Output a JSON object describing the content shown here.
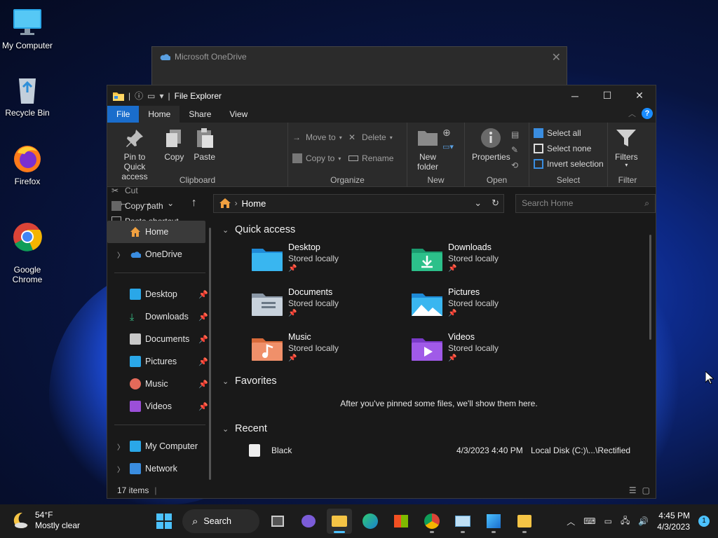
{
  "desktop": {
    "icons": [
      {
        "label": "My Computer"
      },
      {
        "label": "Recycle Bin"
      },
      {
        "label": "Firefox"
      },
      {
        "label": "Google\nChrome"
      }
    ]
  },
  "onedrive_window": {
    "title": "Microsoft OneDrive"
  },
  "explorer": {
    "title": "File Explorer",
    "tabs": [
      "File",
      "Home",
      "Share",
      "View"
    ],
    "ribbon": {
      "clipboard": {
        "pin": "Pin to Quick access",
        "copy": "Copy",
        "paste": "Paste",
        "cut": "Cut",
        "copy_path": "Copy path",
        "paste_shortcut": "Paste shortcut",
        "label": "Clipboard"
      },
      "organize": {
        "move_to": "Move to",
        "copy_to": "Copy to",
        "delete": "Delete",
        "rename": "Rename",
        "label": "Organize"
      },
      "new": {
        "new_folder": "New folder",
        "label": "New"
      },
      "open": {
        "properties": "Properties",
        "label": "Open"
      },
      "select": {
        "select_all": "Select all",
        "select_none": "Select none",
        "invert": "Invert selection",
        "label": "Select"
      },
      "filter": {
        "filters": "Filters",
        "label": "Filter"
      }
    },
    "address": {
      "path": "Home"
    },
    "search": {
      "placeholder": "Search Home"
    },
    "sidebar": {
      "items": [
        {
          "label": "Home"
        },
        {
          "label": "OneDrive"
        },
        {
          "label": "Desktop"
        },
        {
          "label": "Downloads"
        },
        {
          "label": "Documents"
        },
        {
          "label": "Pictures"
        },
        {
          "label": "Music"
        },
        {
          "label": "Videos"
        },
        {
          "label": "My Computer"
        },
        {
          "label": "Network"
        }
      ]
    },
    "quick_access": {
      "heading": "Quick access",
      "items": [
        {
          "name": "Desktop",
          "status": "Stored locally"
        },
        {
          "name": "Downloads",
          "status": "Stored locally"
        },
        {
          "name": "Documents",
          "status": "Stored locally"
        },
        {
          "name": "Pictures",
          "status": "Stored locally"
        },
        {
          "name": "Music",
          "status": "Stored locally"
        },
        {
          "name": "Videos",
          "status": "Stored locally"
        }
      ]
    },
    "favorites": {
      "heading": "Favorites",
      "message": "After you've pinned some files, we'll show them here."
    },
    "recent": {
      "heading": "Recent",
      "items": [
        {
          "name": "Black",
          "date": "4/3/2023 4:40 PM",
          "location": "Local Disk (C:)\\...\\Rectified"
        }
      ]
    },
    "status": {
      "count": "17 items"
    }
  },
  "taskbar": {
    "weather_temp": "54°F",
    "weather_desc": "Mostly clear",
    "search_label": "Search",
    "time": "4:45 PM",
    "date": "4/3/2023",
    "notifications": "1"
  }
}
